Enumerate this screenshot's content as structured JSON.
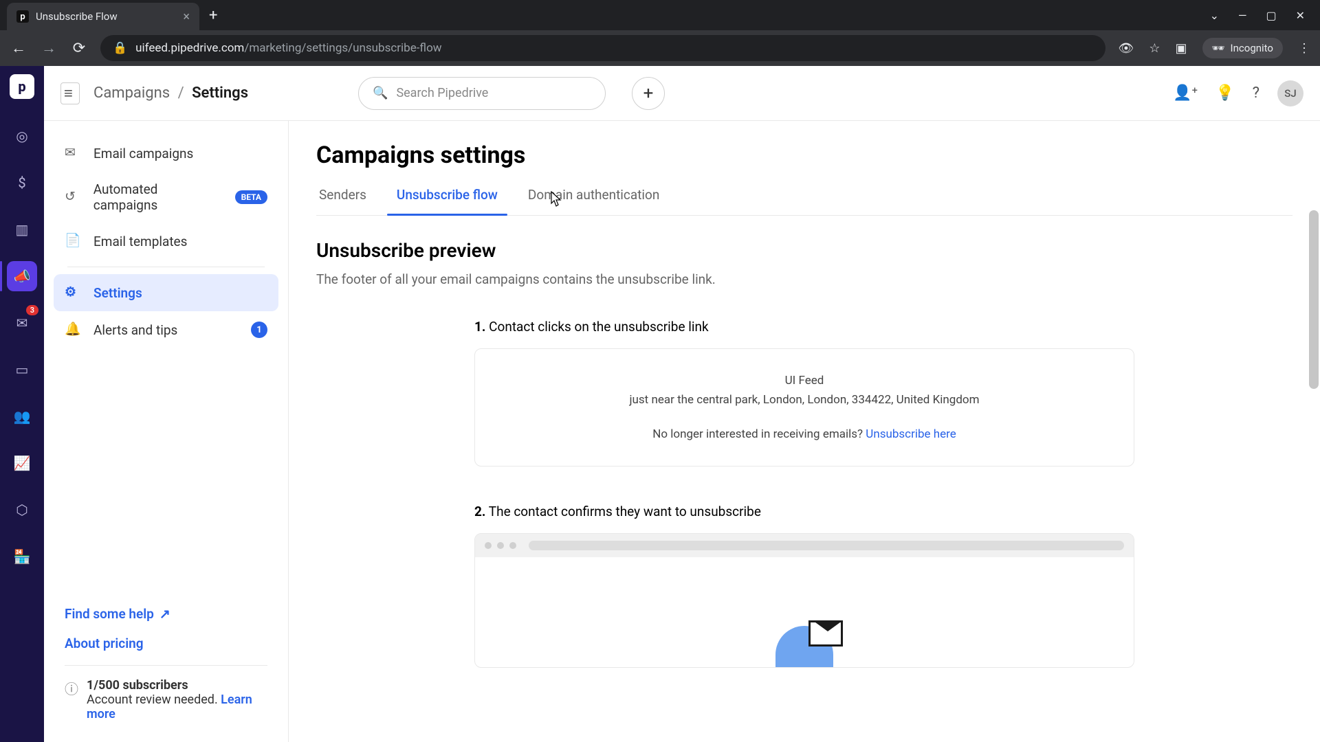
{
  "browser": {
    "tab_title": "Unsubscribe Flow",
    "url_host": "uifeed.pipedrive.com",
    "url_path": "/marketing/settings/unsubscribe-flow",
    "incognito": "Incognito"
  },
  "topbar": {
    "breadcrumb_root": "Campaigns",
    "breadcrumb_current": "Settings",
    "search_placeholder": "Search Pipedrive",
    "avatar": "SJ"
  },
  "rail": {
    "mail_badge": "3"
  },
  "sidebar": {
    "items": [
      {
        "label": "Email campaigns"
      },
      {
        "label": "Automated campaigns",
        "beta": "BETA"
      },
      {
        "label": "Email templates"
      },
      {
        "label": "Settings"
      },
      {
        "label": "Alerts and tips",
        "count": "1"
      }
    ],
    "help_link": "Find some help",
    "pricing_link": "About pricing",
    "sub_count": "1/500 subscribers",
    "sub_review": "Account review needed.",
    "learn_more": "Learn more"
  },
  "content": {
    "page_title": "Campaigns settings",
    "tabs": [
      {
        "label": "Senders"
      },
      {
        "label": "Unsubscribe flow"
      },
      {
        "label": "Domain authentication"
      }
    ],
    "section_title": "Unsubscribe preview",
    "section_desc": "The footer of all your email campaigns contains the unsubscribe link.",
    "step1_num": "1.",
    "step1_text": "Contact clicks on the unsubscribe link",
    "footer_org": "UI Feed",
    "footer_addr": "just near the central park, London, London, 334422, United Kingdom",
    "footer_unsub_text": "No longer interested in receiving emails? ",
    "footer_unsub_link": "Unsubscribe here",
    "step2_num": "2.",
    "step2_text": "The contact confirms they want to unsubscribe"
  }
}
